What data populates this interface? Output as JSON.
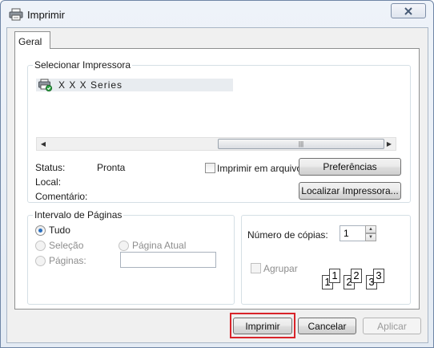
{
  "window": {
    "title": "Imprimir"
  },
  "tabs": [
    {
      "label": "Geral"
    }
  ],
  "select_printer": {
    "group_title": "Selecionar Impressora",
    "printer_name": "X X X  Series",
    "print_to_file_label": "Imprimir em arquivo",
    "preferences_button": "Preferências",
    "find_printer_button": "Localizar Impressora...",
    "status_label": "Status:",
    "status_value": "Pronta",
    "location_label": "Local:",
    "location_value": "",
    "comment_label": "Comentário:",
    "comment_value": ""
  },
  "page_range": {
    "group_title": "Intervalo de Páginas",
    "all_label": "Tudo",
    "selection_label": "Seleção",
    "current_page_label": "Página Atual",
    "pages_label": "Páginas:",
    "pages_value": ""
  },
  "copies": {
    "number_label": "Número de cópias:",
    "number_value": "1",
    "collate_label": "Agrupar",
    "collate_pages": [
      "1",
      "1",
      "2",
      "2",
      "3",
      "3"
    ]
  },
  "footer": {
    "print_button": "Imprimir",
    "cancel_button": "Cancelar",
    "apply_button": "Aplicar"
  },
  "colors": {
    "highlight_border": "#d8242a",
    "accent_radio": "#2a6fbf"
  }
}
